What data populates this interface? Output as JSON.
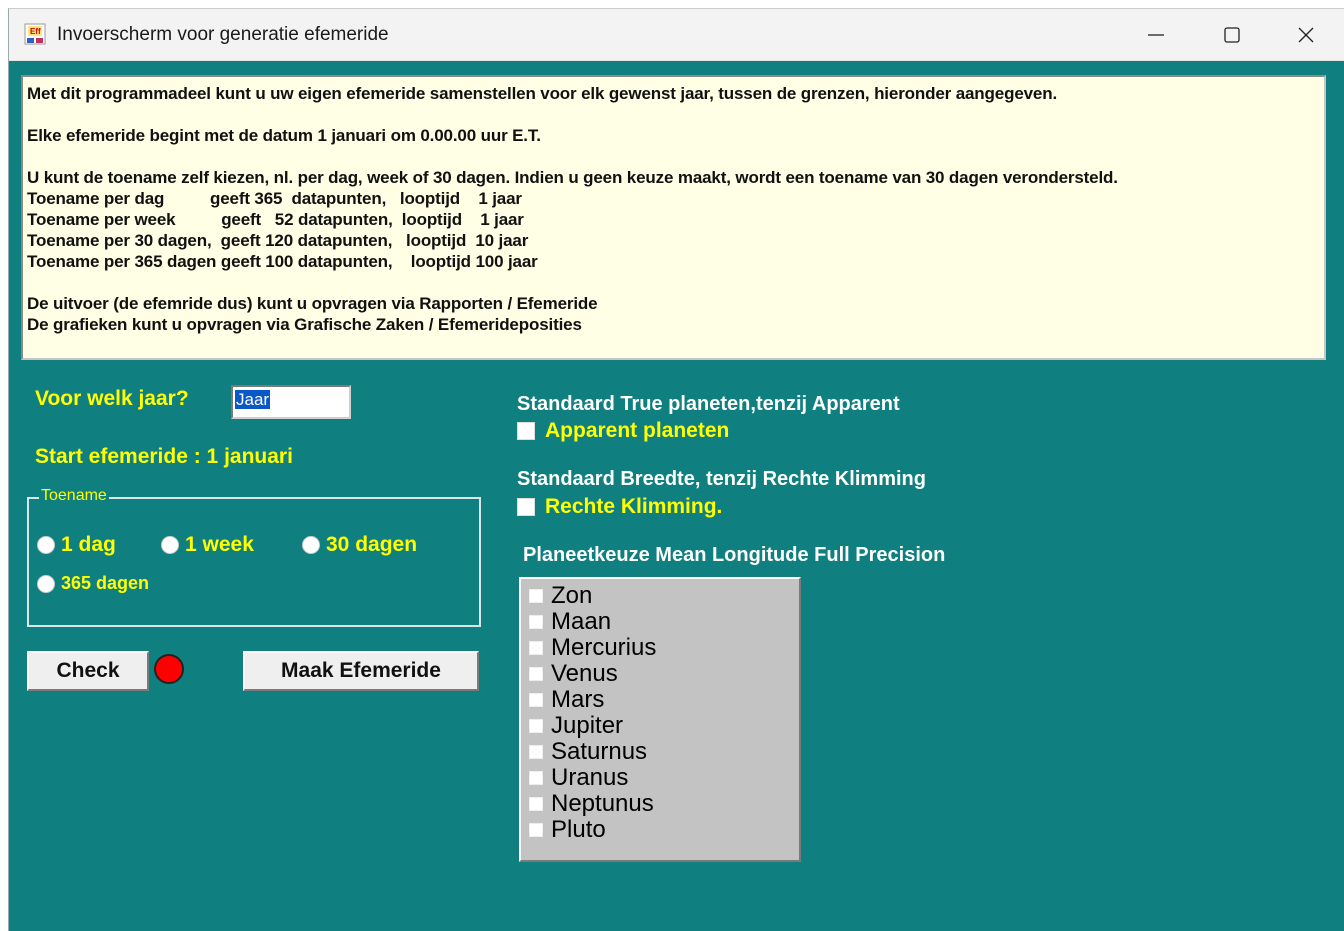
{
  "window": {
    "title": "Invoerscherm voor generatie efemeride"
  },
  "info": {
    "lines": [
      "Met dit programmadeel kunt u uw eigen efemeride samenstellen voor elk gewenst jaar, tussen de grenzen, hieronder aangegeven.",
      "",
      "Elke efemeride begint met de datum 1 januari om 0.00.00 uur E.T.",
      "",
      "U kunt de toename zelf kiezen, nl. per dag, week of 30 dagen. Indien u geen keuze maakt, wordt een toename van 30 dagen verondersteld.",
      "Toename per dag          geeft 365  datapunten,   looptijd    1 jaar",
      "Toename per week          geeft   52 datapunten,  looptijd    1 jaar",
      "Toename per 30 dagen,  geeft 120 datapunten,   looptijd  10 jaar",
      "Toename per 365 dagen geeft 100 datapunten,    looptijd 100 jaar",
      "",
      "De uitvoer (de efemride dus) kunt u opvragen via Rapporten / Efemeride",
      "De grafieken kunt u opvragen via Grafische Zaken / Efemerideposities"
    ]
  },
  "form": {
    "year_label": "Voor welk jaar?",
    "year_value": "Jaar",
    "start_label": "Start efemeride : 1 januari",
    "group_title": "Toename",
    "radios": [
      "1 dag",
      "1 week",
      "30 dagen",
      "365 dagen"
    ],
    "check_button": "Check",
    "make_button": "Maak Efemeride",
    "status_color": "#ff0000"
  },
  "options": {
    "true_label": "Standaard True planeten,tenzij Apparent",
    "apparent_label": "Apparent planeten",
    "breedte_label": "Standaard Breedte, tenzij Rechte Klimming",
    "rk_label": "Rechte Klimming.",
    "planet_title": "Planeetkeuze Mean Longitude Full Precision"
  },
  "planets": [
    "Zon",
    "Maan",
    "Mercurius",
    "Venus",
    "Mars",
    "Jupiter",
    "Saturnus",
    "Uranus",
    "Neptunus",
    "Pluto"
  ],
  "colors": {
    "background": "#0f7f7f",
    "label_yellow": "#ffff00",
    "info_bg": "#ffffe6"
  }
}
